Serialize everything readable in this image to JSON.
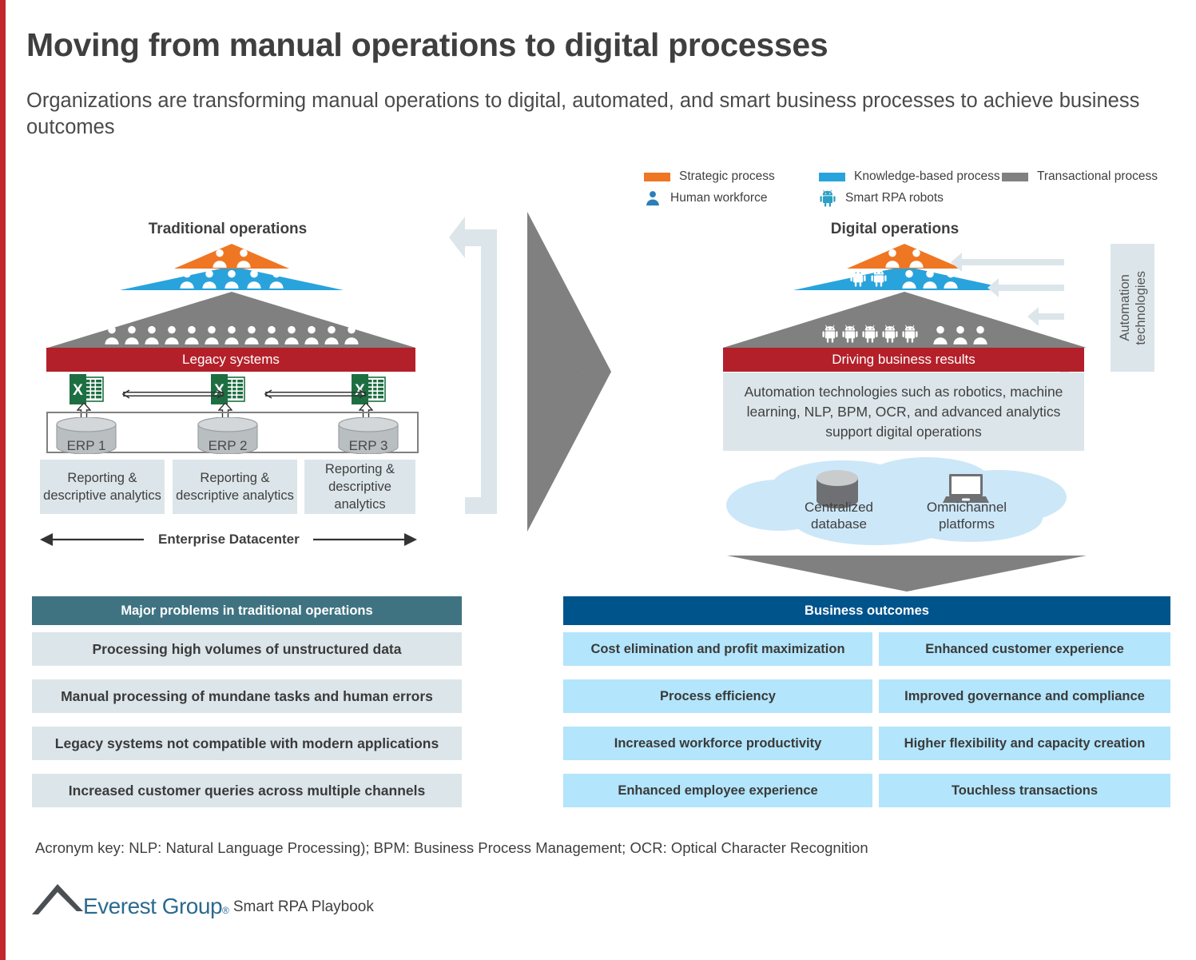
{
  "header": {
    "title": "Moving from manual operations to digital processes",
    "subtitle": "Organizations are transforming manual operations to digital, automated, and smart business processes to achieve business outcomes",
    "accent_color": "#c1272d"
  },
  "legend": {
    "items": [
      {
        "label": "Strategic process",
        "type": "swatch",
        "color": "#ef7622"
      },
      {
        "label": "Knowledge-based process",
        "type": "swatch",
        "color": "#29a3dc"
      },
      {
        "label": "Transactional process",
        "type": "swatch",
        "color": "#808080"
      },
      {
        "label": "Human workforce",
        "type": "icon",
        "icon": "person-icon",
        "color": "#2b7fb8"
      },
      {
        "label": "Smart RPA robots",
        "type": "icon",
        "icon": "robot-icon",
        "color": "#2b9fc4"
      }
    ]
  },
  "traditional": {
    "title": "Traditional operations",
    "pyramid": {
      "tiers": [
        {
          "name": "strategic",
          "color": "#ef7622",
          "humans": 2,
          "robots": 0
        },
        {
          "name": "knowledge",
          "color": "#29a3dc",
          "humans": 5,
          "robots": 0
        },
        {
          "name": "transactional",
          "color": "#808080",
          "humans": 13,
          "robots": 0
        }
      ]
    },
    "band_label": "Legacy systems",
    "erp_nodes": [
      "ERP 1",
      "ERP 2",
      "ERP 3"
    ],
    "analytics_boxes": [
      "Reporting & descriptive analytics",
      "Reporting & descriptive analytics",
      "Reporting & descriptive analytics"
    ],
    "datacenter_label": "Enterprise Datacenter"
  },
  "digital": {
    "title": "Digital operations",
    "pyramid": {
      "tiers": [
        {
          "name": "strategic",
          "color": "#ef7622",
          "humans": 2,
          "robots": 0
        },
        {
          "name": "knowledge",
          "color": "#29a3dc",
          "humans": 3,
          "robots": 2
        },
        {
          "name": "transactional",
          "color": "#808080",
          "humans": 3,
          "robots": 5
        }
      ]
    },
    "band_label": "Driving business results",
    "description": "Automation technologies such as robotics, machine learning, NLP, BPM, OCR, and advanced analytics support digital operations",
    "automation_label": "Automation\ntechnologies",
    "cloud": {
      "items": [
        {
          "icon": "database-icon",
          "label": "Centralized\ndatabase"
        },
        {
          "icon": "laptop-icon",
          "label": "Omnichannel\nplatforms"
        }
      ]
    }
  },
  "problems": {
    "heading": "Major problems in traditional operations",
    "heading_color": "#3f7382",
    "items": [
      "Processing high volumes of unstructured data",
      "Manual processing of mundane tasks and human errors",
      "Legacy systems not compatible with modern applications",
      "Increased customer queries across multiple channels"
    ]
  },
  "outcomes": {
    "heading": "Business outcomes",
    "heading_color": "#00548c",
    "left_items": [
      "Cost elimination and profit maximization",
      "Process efficiency",
      "Increased workforce productivity",
      "Enhanced employee experience"
    ],
    "right_items": [
      "Enhanced customer experience",
      "Improved governance and compliance",
      "Higher flexibility and capacity creation",
      "Touchless transactions"
    ]
  },
  "footer": {
    "acronym_key": "Acronym key: NLP: Natural Language Processing); BPM: Business Process Management; OCR: Optical Character Recognition",
    "brand": "Everest Group",
    "brand_mark": "®",
    "tagline": "Smart RPA Playbook"
  }
}
